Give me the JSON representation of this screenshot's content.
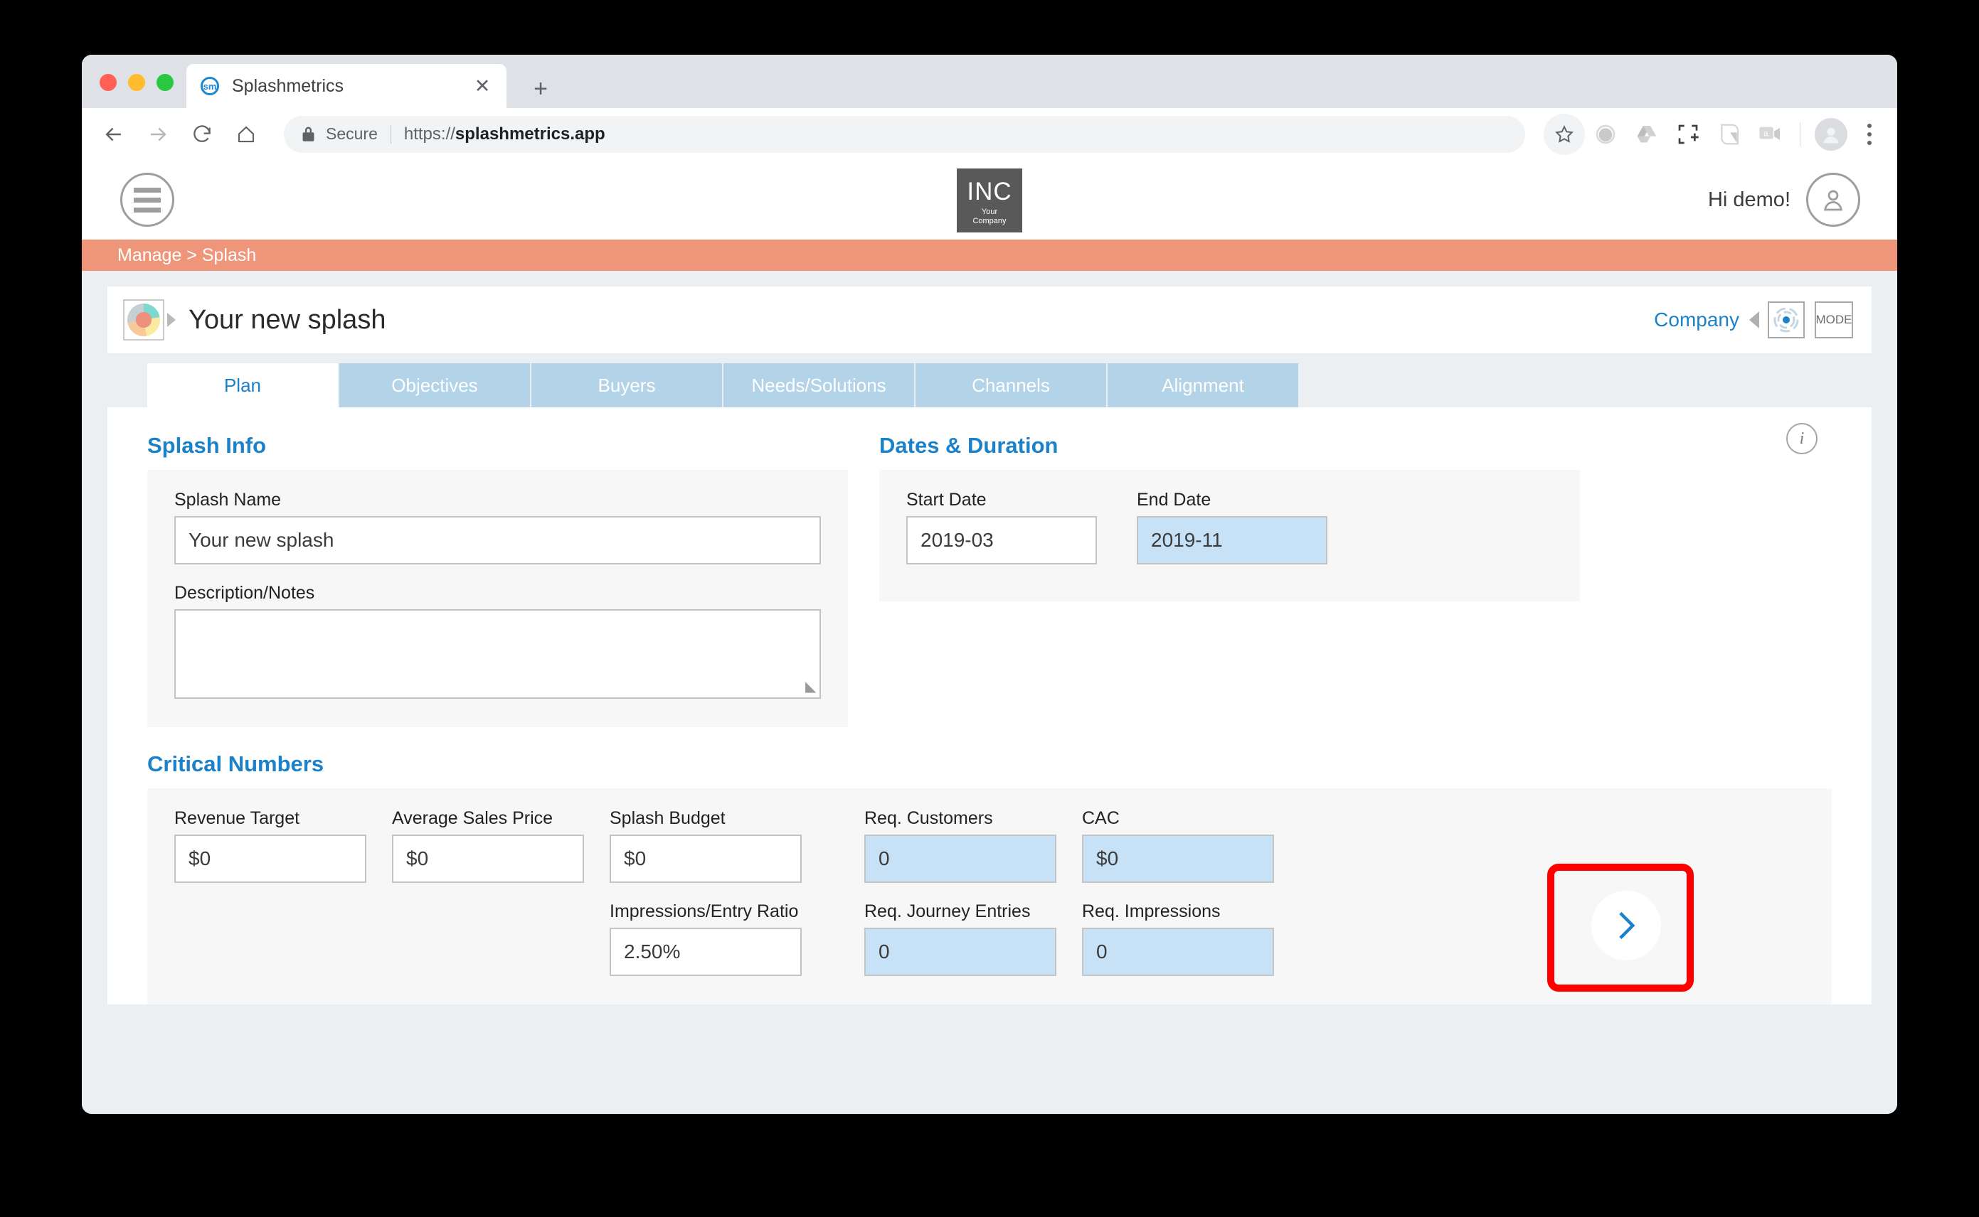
{
  "browser": {
    "tab": {
      "title": "Splashmetrics",
      "favicon_label": "sm",
      "close_label": "✕"
    },
    "new_tab_label": "+",
    "omnibox": {
      "security_label": "Secure",
      "url_scheme": "https://",
      "url_domain": "splashmetrics.app"
    },
    "toolbar_icons": [
      "bookmark-star-icon",
      "extension-circle-icon",
      "google-drive-icon",
      "screenshot-crop-icon",
      "evernote-icon",
      "video-chat-icon",
      "profile-avatar-icon",
      "more-menu-icon"
    ]
  },
  "app": {
    "menu_icon": "hamburger-menu-icon",
    "logo": {
      "title": "INC",
      "line1": "Your",
      "line2": "Company"
    },
    "greeting": "Hi demo!",
    "user_icon": "user-avatar-icon",
    "breadcrumb": "Manage > Splash"
  },
  "splash": {
    "title": "Your new splash",
    "company_label": "Company",
    "mode_label": "MODE",
    "info_icon_label": "i"
  },
  "tabs": [
    {
      "label": "Plan",
      "active": true
    },
    {
      "label": "Objectives",
      "active": false
    },
    {
      "label": "Buyers",
      "active": false
    },
    {
      "label": "Needs/Solutions",
      "active": false
    },
    {
      "label": "Channels",
      "active": false
    },
    {
      "label": "Alignment",
      "active": false
    }
  ],
  "splash_info": {
    "heading": "Splash Info",
    "name_label": "Splash Name",
    "name_value": "Your new splash",
    "description_label": "Description/Notes",
    "description_value": ""
  },
  "dates": {
    "heading": "Dates & Duration",
    "start_label": "Start Date",
    "start_value": "2019-03",
    "end_label": "End Date",
    "end_value": "2019-11"
  },
  "critical_numbers": {
    "heading": "Critical Numbers",
    "revenue_target_label": "Revenue Target",
    "revenue_target_value": "$0",
    "average_sales_price_label": "Average Sales Price",
    "average_sales_price_value": "$0",
    "splash_budget_label": "Splash Budget",
    "splash_budget_value": "$0",
    "impressions_ratio_label": "Impressions/Entry Ratio",
    "impressions_ratio_value": "2.50%",
    "req_customers_label": "Req. Customers",
    "req_customers_value": "0",
    "cac_label": "CAC",
    "cac_value": "$0",
    "req_journey_entries_label": "Req. Journey Entries",
    "req_journey_entries_value": "0",
    "req_impressions_label": "Req. Impressions",
    "req_impressions_value": "0"
  },
  "next_button": {
    "icon": "chevron-right-icon"
  },
  "colors": {
    "accent_blue": "#1b81c9",
    "breadcrumb_coral": "#ef9579",
    "tab_inactive": "#b3d3e8",
    "computed_field": "#c7e2f7",
    "highlight_red": "#ff0000",
    "page_bg": "#eceff1"
  }
}
